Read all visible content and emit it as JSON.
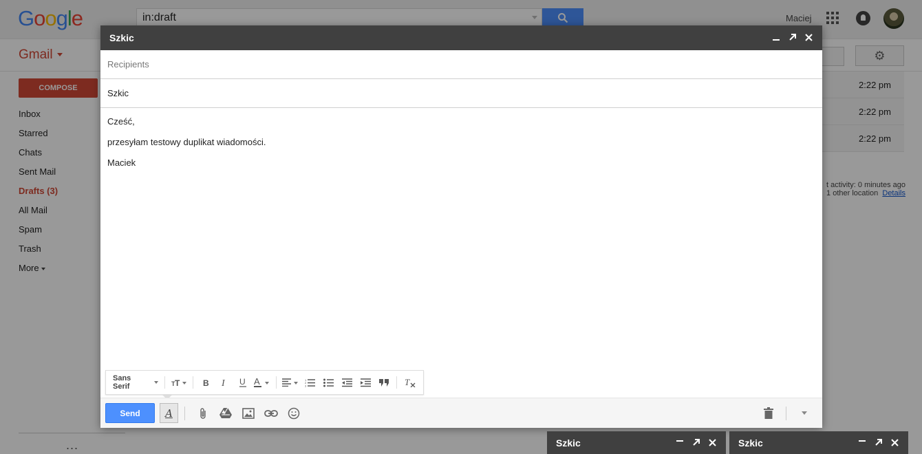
{
  "header": {
    "logo": [
      "G",
      "o",
      "o",
      "g",
      "l",
      "e"
    ],
    "logo_colors": [
      "#4285f4",
      "#ea4335",
      "#fbbc05",
      "#4285f4",
      "#34a853",
      "#ea4335"
    ],
    "search_value": "in:draft",
    "user_name": "Maciej"
  },
  "sidebar": {
    "app_label": "Gmail",
    "compose_label": "COMPOSE",
    "items": [
      {
        "label": "Inbox"
      },
      {
        "label": "Starred"
      },
      {
        "label": "Chats"
      },
      {
        "label": "Sent Mail"
      },
      {
        "label": "Drafts (3)"
      },
      {
        "label": "All Mail"
      },
      {
        "label": "Spam"
      },
      {
        "label": "Trash"
      },
      {
        "label": "More"
      }
    ],
    "footer_dots": "..."
  },
  "mail_list": {
    "times": [
      "2:22 pm",
      "2:22 pm",
      "2:22 pm"
    ],
    "activity_line1": "t activity: 0 minutes ago",
    "activity_line2": "1 other location",
    "activity_link": "Details"
  },
  "compose": {
    "title": "Szkic",
    "recipients_placeholder": "Recipients",
    "subject": "Szkic",
    "body": [
      "Cześć,",
      "przesyłam testowy duplikat wiadomości.",
      "Maciek"
    ],
    "font_name": "Sans Serif",
    "send_label": "Send",
    "format_toggle_glyph": "A",
    "accent_color": "#4d90fe"
  },
  "minimized_drafts": [
    {
      "title": "Szkic"
    },
    {
      "title": "Szkic"
    }
  ]
}
